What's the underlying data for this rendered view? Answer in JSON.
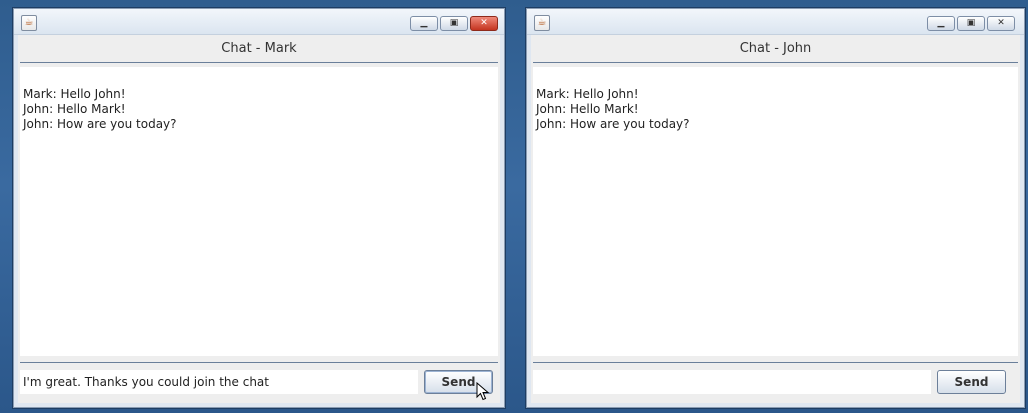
{
  "windows": [
    {
      "title": "Chat - Mark",
      "messages": [
        "Mark: Hello John!",
        "John: Hello Mark!",
        "John: How are you today?"
      ],
      "input_value": "I'm great. Thanks you could join the chat",
      "send_label": "Send"
    },
    {
      "title": "Chat - John",
      "messages": [
        "Mark: Hello John!",
        "John: Hello Mark!",
        "John: How are you today?"
      ],
      "input_value": "",
      "send_label": "Send"
    }
  ],
  "icons": {
    "app": "java-app-icon",
    "minimize": "minimize-icon",
    "maximize": "maximize-icon",
    "close": "close-icon",
    "pointer": "mouse-pointer-icon"
  }
}
